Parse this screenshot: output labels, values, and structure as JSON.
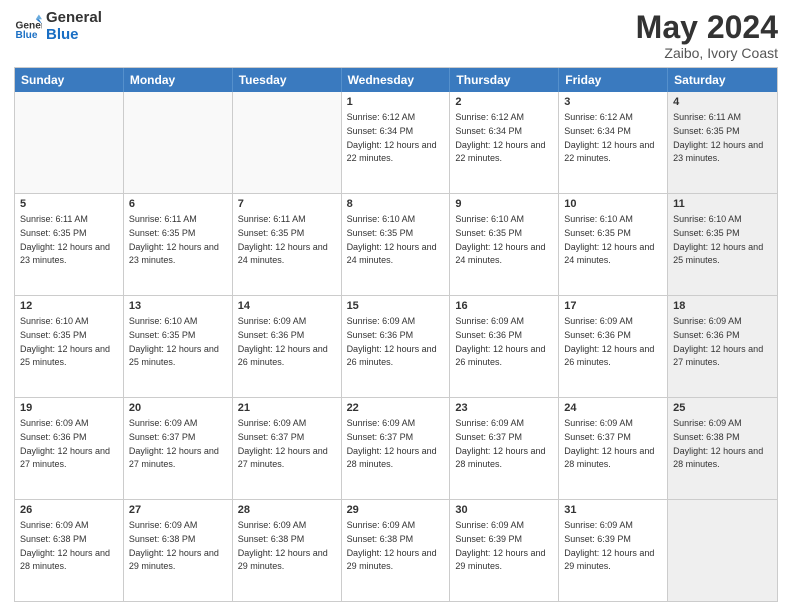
{
  "header": {
    "logo_line1": "General",
    "logo_line2": "Blue",
    "month_title": "May 2024",
    "location": "Zaibo, Ivory Coast"
  },
  "days_of_week": [
    "Sunday",
    "Monday",
    "Tuesday",
    "Wednesday",
    "Thursday",
    "Friday",
    "Saturday"
  ],
  "weeks": [
    [
      {
        "day": "",
        "info": "",
        "empty": true
      },
      {
        "day": "",
        "info": "",
        "empty": true
      },
      {
        "day": "",
        "info": "",
        "empty": true
      },
      {
        "day": "1",
        "info": "Sunrise: 6:12 AM\nSunset: 6:34 PM\nDaylight: 12 hours and 22 minutes."
      },
      {
        "day": "2",
        "info": "Sunrise: 6:12 AM\nSunset: 6:34 PM\nDaylight: 12 hours and 22 minutes."
      },
      {
        "day": "3",
        "info": "Sunrise: 6:12 AM\nSunset: 6:34 PM\nDaylight: 12 hours and 22 minutes."
      },
      {
        "day": "4",
        "info": "Sunrise: 6:11 AM\nSunset: 6:35 PM\nDaylight: 12 hours and 23 minutes.",
        "shaded": true
      }
    ],
    [
      {
        "day": "5",
        "info": "Sunrise: 6:11 AM\nSunset: 6:35 PM\nDaylight: 12 hours and 23 minutes."
      },
      {
        "day": "6",
        "info": "Sunrise: 6:11 AM\nSunset: 6:35 PM\nDaylight: 12 hours and 23 minutes."
      },
      {
        "day": "7",
        "info": "Sunrise: 6:11 AM\nSunset: 6:35 PM\nDaylight: 12 hours and 24 minutes."
      },
      {
        "day": "8",
        "info": "Sunrise: 6:10 AM\nSunset: 6:35 PM\nDaylight: 12 hours and 24 minutes."
      },
      {
        "day": "9",
        "info": "Sunrise: 6:10 AM\nSunset: 6:35 PM\nDaylight: 12 hours and 24 minutes."
      },
      {
        "day": "10",
        "info": "Sunrise: 6:10 AM\nSunset: 6:35 PM\nDaylight: 12 hours and 24 minutes."
      },
      {
        "day": "11",
        "info": "Sunrise: 6:10 AM\nSunset: 6:35 PM\nDaylight: 12 hours and 25 minutes.",
        "shaded": true
      }
    ],
    [
      {
        "day": "12",
        "info": "Sunrise: 6:10 AM\nSunset: 6:35 PM\nDaylight: 12 hours and 25 minutes."
      },
      {
        "day": "13",
        "info": "Sunrise: 6:10 AM\nSunset: 6:35 PM\nDaylight: 12 hours and 25 minutes."
      },
      {
        "day": "14",
        "info": "Sunrise: 6:09 AM\nSunset: 6:36 PM\nDaylight: 12 hours and 26 minutes."
      },
      {
        "day": "15",
        "info": "Sunrise: 6:09 AM\nSunset: 6:36 PM\nDaylight: 12 hours and 26 minutes."
      },
      {
        "day": "16",
        "info": "Sunrise: 6:09 AM\nSunset: 6:36 PM\nDaylight: 12 hours and 26 minutes."
      },
      {
        "day": "17",
        "info": "Sunrise: 6:09 AM\nSunset: 6:36 PM\nDaylight: 12 hours and 26 minutes."
      },
      {
        "day": "18",
        "info": "Sunrise: 6:09 AM\nSunset: 6:36 PM\nDaylight: 12 hours and 27 minutes.",
        "shaded": true
      }
    ],
    [
      {
        "day": "19",
        "info": "Sunrise: 6:09 AM\nSunset: 6:36 PM\nDaylight: 12 hours and 27 minutes."
      },
      {
        "day": "20",
        "info": "Sunrise: 6:09 AM\nSunset: 6:37 PM\nDaylight: 12 hours and 27 minutes."
      },
      {
        "day": "21",
        "info": "Sunrise: 6:09 AM\nSunset: 6:37 PM\nDaylight: 12 hours and 27 minutes."
      },
      {
        "day": "22",
        "info": "Sunrise: 6:09 AM\nSunset: 6:37 PM\nDaylight: 12 hours and 28 minutes."
      },
      {
        "day": "23",
        "info": "Sunrise: 6:09 AM\nSunset: 6:37 PM\nDaylight: 12 hours and 28 minutes."
      },
      {
        "day": "24",
        "info": "Sunrise: 6:09 AM\nSunset: 6:37 PM\nDaylight: 12 hours and 28 minutes."
      },
      {
        "day": "25",
        "info": "Sunrise: 6:09 AM\nSunset: 6:38 PM\nDaylight: 12 hours and 28 minutes.",
        "shaded": true
      }
    ],
    [
      {
        "day": "26",
        "info": "Sunrise: 6:09 AM\nSunset: 6:38 PM\nDaylight: 12 hours and 28 minutes."
      },
      {
        "day": "27",
        "info": "Sunrise: 6:09 AM\nSunset: 6:38 PM\nDaylight: 12 hours and 29 minutes."
      },
      {
        "day": "28",
        "info": "Sunrise: 6:09 AM\nSunset: 6:38 PM\nDaylight: 12 hours and 29 minutes."
      },
      {
        "day": "29",
        "info": "Sunrise: 6:09 AM\nSunset: 6:38 PM\nDaylight: 12 hours and 29 minutes."
      },
      {
        "day": "30",
        "info": "Sunrise: 6:09 AM\nSunset: 6:39 PM\nDaylight: 12 hours and 29 minutes."
      },
      {
        "day": "31",
        "info": "Sunrise: 6:09 AM\nSunset: 6:39 PM\nDaylight: 12 hours and 29 minutes."
      },
      {
        "day": "",
        "info": "",
        "empty": true,
        "shaded": true
      }
    ]
  ]
}
